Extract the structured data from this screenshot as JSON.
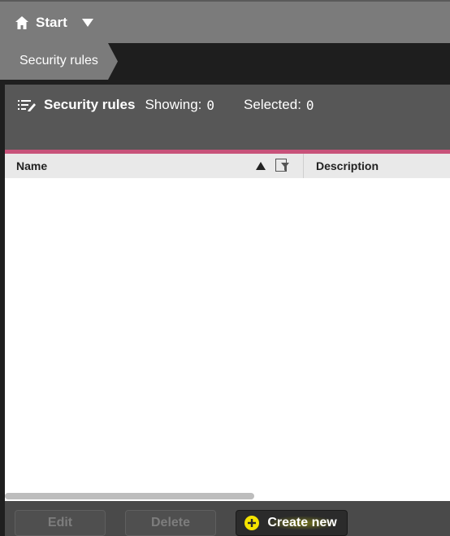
{
  "topbar": {
    "home_label": "Start",
    "home_icon": "home-icon",
    "menu_icon": "caret-down-icon"
  },
  "breadcrumb": {
    "current": "Security rules"
  },
  "panel": {
    "title": "Security rules",
    "title_icon": "list-edit-icon",
    "showing_label": "Showing:",
    "showing_count": "0",
    "selected_label": "Selected:",
    "selected_count": "0",
    "accent_color": "#c8527a"
  },
  "table": {
    "columns": [
      {
        "label": "Name",
        "sort": "ascending",
        "filter_icon": "filter-icon"
      },
      {
        "label": "Description"
      }
    ],
    "rows": []
  },
  "actions": {
    "edit_label": "Edit",
    "delete_label": "Delete",
    "create_label": "Create new",
    "create_icon": "plus-circle-icon",
    "highlight_color": "#ffff00"
  }
}
